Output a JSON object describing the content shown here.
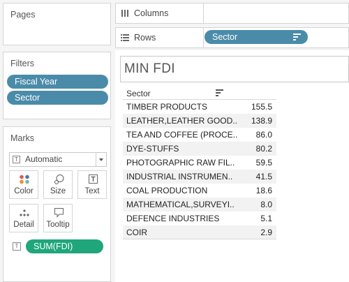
{
  "pages": {
    "title": "Pages"
  },
  "filters": {
    "title": "Filters",
    "items": [
      "Fiscal Year",
      "Sector"
    ]
  },
  "marks": {
    "title": "Marks",
    "mark_type": "Automatic",
    "buttons": {
      "color": "Color",
      "size": "Size",
      "text": "Text",
      "detail": "Detail",
      "tooltip": "Tooltip"
    },
    "text_pill": "SUM(FDI)"
  },
  "shelves": {
    "columns": "Columns",
    "rows": "Rows",
    "rows_pill": "Sector"
  },
  "sheet": {
    "title": "MIN FDI"
  },
  "table": {
    "header": "Sector",
    "rows": [
      {
        "sector": "TIMBER PRODUCTS",
        "value": "155.5"
      },
      {
        "sector": "LEATHER,LEATHER GOOD..",
        "value": "138.9"
      },
      {
        "sector": "TEA AND COFFEE (PROCE..",
        "value": "86.0"
      },
      {
        "sector": "DYE-STUFFS",
        "value": "80.2"
      },
      {
        "sector": "PHOTOGRAPHIC RAW FIL..",
        "value": "59.5"
      },
      {
        "sector": "INDUSTRIAL INSTRUMEN..",
        "value": "41.5"
      },
      {
        "sector": "COAL PRODUCTION",
        "value": "18.6"
      },
      {
        "sector": "MATHEMATICAL,SURVEYI..",
        "value": "8.0"
      },
      {
        "sector": "DEFENCE INDUSTRIES",
        "value": "5.1"
      },
      {
        "sector": "COIR",
        "value": "2.9"
      }
    ]
  },
  "colors": {
    "pill_blue": "#4a8ba9",
    "pill_green": "#1fa67a"
  }
}
